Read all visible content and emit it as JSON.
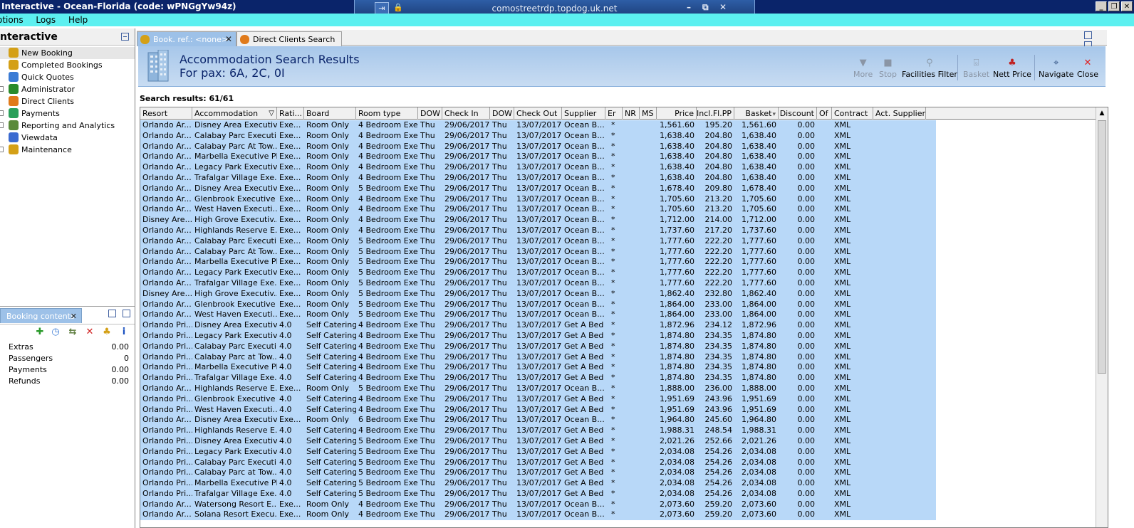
{
  "window": {
    "title": "Interactive - Ocean-Florida (code: wPNGgYw94z)",
    "rdp_host": "comostreetrdp.topdog.uk.net",
    "rdp_pin": "⇥",
    "rdp_lock": "🔒",
    "rdp_min": "–",
    "rdp_restore": "⧉",
    "rdp_close": "✕",
    "min": "_",
    "restore": "❐",
    "close": "✕"
  },
  "menu": [
    "Options",
    "Logs",
    "Help"
  ],
  "menu_visible": [
    "otions",
    "Logs",
    "Help"
  ],
  "left_panel": {
    "title": "nteractive",
    "items": [
      {
        "label": "New Booking",
        "icon": "palm-tree-icon",
        "color": "#d4a017",
        "selected": true,
        "toggle": false
      },
      {
        "label": "Completed Bookings",
        "icon": "palm-tree-icon",
        "color": "#d4a017",
        "selected": false,
        "toggle": false
      },
      {
        "label": "Quick Quotes",
        "icon": "clock-icon",
        "color": "#3a7bd5",
        "selected": false,
        "toggle": false
      },
      {
        "label": "Administrator",
        "icon": "person-icon",
        "color": "#2a8a2a",
        "selected": false,
        "toggle": true
      },
      {
        "label": "Direct Clients",
        "icon": "house-icon",
        "color": "#e07a1a",
        "selected": false,
        "toggle": false
      },
      {
        "label": "Payments",
        "icon": "payments-icon",
        "color": "#2aa05a",
        "selected": false,
        "toggle": true
      },
      {
        "label": "Reporting and Analytics",
        "icon": "report-icon",
        "color": "#5a8a3a",
        "selected": false,
        "toggle": true
      },
      {
        "label": "Viewdata",
        "icon": "globe-icon",
        "color": "#3a6ad0",
        "selected": false,
        "toggle": false
      },
      {
        "label": "Maintenance",
        "icon": "maintenance-icon",
        "color": "#d4a017",
        "selected": false,
        "toggle": true
      }
    ]
  },
  "booking_panel": {
    "tab_label": "Booking contents",
    "rows": [
      {
        "label": "Extras",
        "value": "0.00"
      },
      {
        "label": "Passengers",
        "value": "0"
      },
      {
        "label": "Payments",
        "value": "0.00"
      },
      {
        "label": "Refunds",
        "value": "0.00"
      }
    ]
  },
  "tabs": [
    {
      "label": "Book. ref.: <none>",
      "active": true
    },
    {
      "label": "Direct Clients Search",
      "active": false
    }
  ],
  "header": {
    "title": "Accommodation Search Results",
    "subtitle": "For pax: 6A, 2C, 0I"
  },
  "toolbar": {
    "more": "More",
    "stop": "Stop",
    "facilities_filter": "Facilities Filter",
    "basket": "Basket",
    "nett_price": "Nett Price",
    "navigate": "Navigate",
    "close": "Close"
  },
  "results_label": "Search results: 61/61",
  "columns": [
    "Resort",
    "Accommodation",
    "Rati...",
    "Board",
    "Room type",
    "DOW",
    "Check In",
    "DOW",
    "Check Out",
    "Supplier",
    "Er",
    "NR",
    "MS",
    "Price",
    "Incl.Fl.PP",
    "Basket",
    "Discount",
    "Of",
    "Contract",
    "Act. Supplier"
  ],
  "rows": [
    [
      "Orlando Ar...",
      "Disney Area Executiv...",
      "Exe...",
      "Room Only",
      "4 Bedroom Exe...",
      "Thu",
      "29/06/2017",
      "Thu",
      "13/07/2017",
      "Ocean B...",
      "*",
      "",
      "",
      "1,561.60",
      "195.20",
      "1,561.60",
      "0.00",
      "",
      "XML",
      ""
    ],
    [
      "Orlando Ar...",
      "Calabay Parc Executi...",
      "Exe...",
      "Room Only",
      "4 Bedroom Exe...",
      "Thu",
      "29/06/2017",
      "Thu",
      "13/07/2017",
      "Ocean B...",
      "*",
      "",
      "",
      "1,638.40",
      "204.80",
      "1,638.40",
      "0.00",
      "",
      "XML",
      ""
    ],
    [
      "Orlando Ar...",
      "Calabay Parc At Tow...",
      "Exe...",
      "Room Only",
      "4 Bedroom Exe...",
      "Thu",
      "29/06/2017",
      "Thu",
      "13/07/2017",
      "Ocean B...",
      "*",
      "",
      "",
      "1,638.40",
      "204.80",
      "1,638.40",
      "0.00",
      "",
      "XML",
      ""
    ],
    [
      "Orlando Ar...",
      "Marbella Executive Pl...",
      "Exe...",
      "Room Only",
      "4 Bedroom Exe...",
      "Thu",
      "29/06/2017",
      "Thu",
      "13/07/2017",
      "Ocean B...",
      "*",
      "",
      "",
      "1,638.40",
      "204.80",
      "1,638.40",
      "0.00",
      "",
      "XML",
      ""
    ],
    [
      "Orlando Ar...",
      "Legacy Park Executiv...",
      "Exe...",
      "Room Only",
      "4 Bedroom Exe...",
      "Thu",
      "29/06/2017",
      "Thu",
      "13/07/2017",
      "Ocean B...",
      "*",
      "",
      "",
      "1,638.40",
      "204.80",
      "1,638.40",
      "0.00",
      "",
      "XML",
      ""
    ],
    [
      "Orlando Ar...",
      "Trafalgar Village Exe...",
      "Exe...",
      "Room Only",
      "4 Bedroom Exe...",
      "Thu",
      "29/06/2017",
      "Thu",
      "13/07/2017",
      "Ocean B...",
      "*",
      "",
      "",
      "1,638.40",
      "204.80",
      "1,638.40",
      "0.00",
      "",
      "XML",
      ""
    ],
    [
      "Orlando Ar...",
      "Disney Area Executiv...",
      "Exe...",
      "Room Only",
      "5 Bedroom Exe...",
      "Thu",
      "29/06/2017",
      "Thu",
      "13/07/2017",
      "Ocean B...",
      "*",
      "",
      "",
      "1,678.40",
      "209.80",
      "1,678.40",
      "0.00",
      "",
      "XML",
      ""
    ],
    [
      "Orlando Ar...",
      "Glenbrook Executive ...",
      "Exe...",
      "Room Only",
      "4 Bedroom Exe...",
      "Thu",
      "29/06/2017",
      "Thu",
      "13/07/2017",
      "Ocean B...",
      "*",
      "",
      "",
      "1,705.60",
      "213.20",
      "1,705.60",
      "0.00",
      "",
      "XML",
      ""
    ],
    [
      "Orlando Ar...",
      "West Haven Executi...",
      "Exe...",
      "Room Only",
      "4 Bedroom Exe...",
      "Thu",
      "29/06/2017",
      "Thu",
      "13/07/2017",
      "Ocean B...",
      "*",
      "",
      "",
      "1,705.60",
      "213.20",
      "1,705.60",
      "0.00",
      "",
      "XML",
      ""
    ],
    [
      "Disney Are...",
      "High Grove Executiv...",
      "Exe...",
      "Room Only",
      "4 Bedroom Exe...",
      "Thu",
      "29/06/2017",
      "Thu",
      "13/07/2017",
      "Ocean B...",
      "*",
      "",
      "",
      "1,712.00",
      "214.00",
      "1,712.00",
      "0.00",
      "",
      "XML",
      ""
    ],
    [
      "Orlando Ar...",
      "Highlands Reserve E...",
      "Exe...",
      "Room Only",
      "4 Bedroom Exe...",
      "Thu",
      "29/06/2017",
      "Thu",
      "13/07/2017",
      "Ocean B...",
      "*",
      "",
      "",
      "1,737.60",
      "217.20",
      "1,737.60",
      "0.00",
      "",
      "XML",
      ""
    ],
    [
      "Orlando Ar...",
      "Calabay Parc Executi...",
      "Exe...",
      "Room Only",
      "5 Bedroom Exe...",
      "Thu",
      "29/06/2017",
      "Thu",
      "13/07/2017",
      "Ocean B...",
      "*",
      "",
      "",
      "1,777.60",
      "222.20",
      "1,777.60",
      "0.00",
      "",
      "XML",
      ""
    ],
    [
      "Orlando Ar...",
      "Calabay Parc At Tow...",
      "Exe...",
      "Room Only",
      "5 Bedroom Exe...",
      "Thu",
      "29/06/2017",
      "Thu",
      "13/07/2017",
      "Ocean B...",
      "*",
      "",
      "",
      "1,777.60",
      "222.20",
      "1,777.60",
      "0.00",
      "",
      "XML",
      ""
    ],
    [
      "Orlando Ar...",
      "Marbella Executive Pl...",
      "Exe...",
      "Room Only",
      "5 Bedroom Exe...",
      "Thu",
      "29/06/2017",
      "Thu",
      "13/07/2017",
      "Ocean B...",
      "*",
      "",
      "",
      "1,777.60",
      "222.20",
      "1,777.60",
      "0.00",
      "",
      "XML",
      ""
    ],
    [
      "Orlando Ar...",
      "Legacy Park Executiv...",
      "Exe...",
      "Room Only",
      "5 Bedroom Exe...",
      "Thu",
      "29/06/2017",
      "Thu",
      "13/07/2017",
      "Ocean B...",
      "*",
      "",
      "",
      "1,777.60",
      "222.20",
      "1,777.60",
      "0.00",
      "",
      "XML",
      ""
    ],
    [
      "Orlando Ar...",
      "Trafalgar Village Exe...",
      "Exe...",
      "Room Only",
      "5 Bedroom Exe...",
      "Thu",
      "29/06/2017",
      "Thu",
      "13/07/2017",
      "Ocean B...",
      "*",
      "",
      "",
      "1,777.60",
      "222.20",
      "1,777.60",
      "0.00",
      "",
      "XML",
      ""
    ],
    [
      "Disney Are...",
      "High Grove Executiv...",
      "Exe...",
      "Room Only",
      "5 Bedroom Exe...",
      "Thu",
      "29/06/2017",
      "Thu",
      "13/07/2017",
      "Ocean B...",
      "*",
      "",
      "",
      "1,862.40",
      "232.80",
      "1,862.40",
      "0.00",
      "",
      "XML",
      ""
    ],
    [
      "Orlando Ar...",
      "Glenbrook Executive ...",
      "Exe...",
      "Room Only",
      "5 Bedroom Exe...",
      "Thu",
      "29/06/2017",
      "Thu",
      "13/07/2017",
      "Ocean B...",
      "*",
      "",
      "",
      "1,864.00",
      "233.00",
      "1,864.00",
      "0.00",
      "",
      "XML",
      ""
    ],
    [
      "Orlando Ar...",
      "West Haven Executi...",
      "Exe...",
      "Room Only",
      "5 Bedroom Exe...",
      "Thu",
      "29/06/2017",
      "Thu",
      "13/07/2017",
      "Ocean B...",
      "*",
      "",
      "",
      "1,864.00",
      "233.00",
      "1,864.00",
      "0.00",
      "",
      "XML",
      ""
    ],
    [
      "Orlando Pri...",
      "Disney Area Executiv...",
      "4.0",
      "Self Catering",
      "4 Bedroom Exe...",
      "Thu",
      "29/06/2017",
      "Thu",
      "13/07/2017",
      "Get A Bed",
      "*",
      "",
      "",
      "1,872.96",
      "234.12",
      "1,872.96",
      "0.00",
      "",
      "XML",
      ""
    ],
    [
      "Orlando Pri...",
      "Legacy Park Executiv...",
      "4.0",
      "Self Catering",
      "4 Bedroom Exe...",
      "Thu",
      "29/06/2017",
      "Thu",
      "13/07/2017",
      "Get A Bed",
      "*",
      "",
      "",
      "1,874.80",
      "234.35",
      "1,874.80",
      "0.00",
      "",
      "XML",
      ""
    ],
    [
      "Orlando Pri...",
      "Calabay Parc Executi...",
      "4.0",
      "Self Catering",
      "4 Bedroom Exe...",
      "Thu",
      "29/06/2017",
      "Thu",
      "13/07/2017",
      "Get A Bed",
      "*",
      "",
      "",
      "1,874.80",
      "234.35",
      "1,874.80",
      "0.00",
      "",
      "XML",
      ""
    ],
    [
      "Orlando Pri...",
      "Calabay Parc at Tow...",
      "4.0",
      "Self Catering",
      "4 Bedroom Exe...",
      "Thu",
      "29/06/2017",
      "Thu",
      "13/07/2017",
      "Get A Bed",
      "*",
      "",
      "",
      "1,874.80",
      "234.35",
      "1,874.80",
      "0.00",
      "",
      "XML",
      ""
    ],
    [
      "Orlando Pri...",
      "Marbella Executive Pl...",
      "4.0",
      "Self Catering",
      "4 Bedroom Exe...",
      "Thu",
      "29/06/2017",
      "Thu",
      "13/07/2017",
      "Get A Bed",
      "*",
      "",
      "",
      "1,874.80",
      "234.35",
      "1,874.80",
      "0.00",
      "",
      "XML",
      ""
    ],
    [
      "Orlando Pri...",
      "Trafalgar Village Exe...",
      "4.0",
      "Self Catering",
      "4 Bedroom Exe...",
      "Thu",
      "29/06/2017",
      "Thu",
      "13/07/2017",
      "Get A Bed",
      "*",
      "",
      "",
      "1,874.80",
      "234.35",
      "1,874.80",
      "0.00",
      "",
      "XML",
      ""
    ],
    [
      "Orlando Ar...",
      "Highlands Reserve E...",
      "Exe...",
      "Room Only",
      "5 Bedroom Exe...",
      "Thu",
      "29/06/2017",
      "Thu",
      "13/07/2017",
      "Ocean B...",
      "*",
      "",
      "",
      "1,888.00",
      "236.00",
      "1,888.00",
      "0.00",
      "",
      "XML",
      ""
    ],
    [
      "Orlando Pri...",
      "Glenbrook Executive ...",
      "4.0",
      "Self Catering",
      "4 Bedroom Exe...",
      "Thu",
      "29/06/2017",
      "Thu",
      "13/07/2017",
      "Get A Bed",
      "*",
      "",
      "",
      "1,951.69",
      "243.96",
      "1,951.69",
      "0.00",
      "",
      "XML",
      ""
    ],
    [
      "Orlando Pri...",
      "West Haven Executi...",
      "4.0",
      "Self Catering",
      "4 Bedroom Exe...",
      "Thu",
      "29/06/2017",
      "Thu",
      "13/07/2017",
      "Get A Bed",
      "*",
      "",
      "",
      "1,951.69",
      "243.96",
      "1,951.69",
      "0.00",
      "",
      "XML",
      ""
    ],
    [
      "Orlando Ar...",
      "Disney Area Executiv...",
      "Exe...",
      "Room Only",
      "6 Bedroom Exe...",
      "Thu",
      "29/06/2017",
      "Thu",
      "13/07/2017",
      "Ocean B...",
      "*",
      "",
      "",
      "1,964.80",
      "245.60",
      "1,964.80",
      "0.00",
      "",
      "XML",
      ""
    ],
    [
      "Orlando Pri...",
      "Highlands Reserve E...",
      "4.0",
      "Self Catering",
      "4 Bedroom Exe...",
      "Thu",
      "29/06/2017",
      "Thu",
      "13/07/2017",
      "Get A Bed",
      "*",
      "",
      "",
      "1,988.31",
      "248.54",
      "1,988.31",
      "0.00",
      "",
      "XML",
      ""
    ],
    [
      "Orlando Pri...",
      "Disney Area Executiv...",
      "4.0",
      "Self Catering",
      "5 Bedroom Exe...",
      "Thu",
      "29/06/2017",
      "Thu",
      "13/07/2017",
      "Get A Bed",
      "*",
      "",
      "",
      "2,021.26",
      "252.66",
      "2,021.26",
      "0.00",
      "",
      "XML",
      ""
    ],
    [
      "Orlando Pri...",
      "Legacy Park Executiv...",
      "4.0",
      "Self Catering",
      "5 Bedroom Exe...",
      "Thu",
      "29/06/2017",
      "Thu",
      "13/07/2017",
      "Get A Bed",
      "*",
      "",
      "",
      "2,034.08",
      "254.26",
      "2,034.08",
      "0.00",
      "",
      "XML",
      ""
    ],
    [
      "Orlando Pri...",
      "Calabay Parc Executi...",
      "4.0",
      "Self Catering",
      "5 Bedroom Exe...",
      "Thu",
      "29/06/2017",
      "Thu",
      "13/07/2017",
      "Get A Bed",
      "*",
      "",
      "",
      "2,034.08",
      "254.26",
      "2,034.08",
      "0.00",
      "",
      "XML",
      ""
    ],
    [
      "Orlando Pri...",
      "Calabay Parc at Tow...",
      "4.0",
      "Self Catering",
      "5 Bedroom Exe...",
      "Thu",
      "29/06/2017",
      "Thu",
      "13/07/2017",
      "Get A Bed",
      "*",
      "",
      "",
      "2,034.08",
      "254.26",
      "2,034.08",
      "0.00",
      "",
      "XML",
      ""
    ],
    [
      "Orlando Pri...",
      "Marbella Executive Pl...",
      "4.0",
      "Self Catering",
      "5 Bedroom Exe...",
      "Thu",
      "29/06/2017",
      "Thu",
      "13/07/2017",
      "Get A Bed",
      "*",
      "",
      "",
      "2,034.08",
      "254.26",
      "2,034.08",
      "0.00",
      "",
      "XML",
      ""
    ],
    [
      "Orlando Pri...",
      "Trafalgar Village Exe...",
      "4.0",
      "Self Catering",
      "5 Bedroom Exe...",
      "Thu",
      "29/06/2017",
      "Thu",
      "13/07/2017",
      "Get A Bed",
      "*",
      "",
      "",
      "2,034.08",
      "254.26",
      "2,034.08",
      "0.00",
      "",
      "XML",
      ""
    ],
    [
      "Orlando Ar...",
      "Watersong Resort E...",
      "Exe...",
      "Room Only",
      "4 Bedroom Exe...",
      "Thu",
      "29/06/2017",
      "Thu",
      "13/07/2017",
      "Ocean B...",
      "*",
      "",
      "",
      "2,073.60",
      "259.20",
      "2,073.60",
      "0.00",
      "",
      "XML",
      ""
    ],
    [
      "Orlando Ar...",
      "Solana Resort Execu...",
      "Exe...",
      "Room Only",
      "4 Bedroom Exe...",
      "Thu",
      "29/06/2017",
      "Thu",
      "13/07/2017",
      "Ocean B...",
      "*",
      "",
      "",
      "2,073.60",
      "259.20",
      "2,073.60",
      "0.00",
      "",
      "XML",
      ""
    ]
  ]
}
